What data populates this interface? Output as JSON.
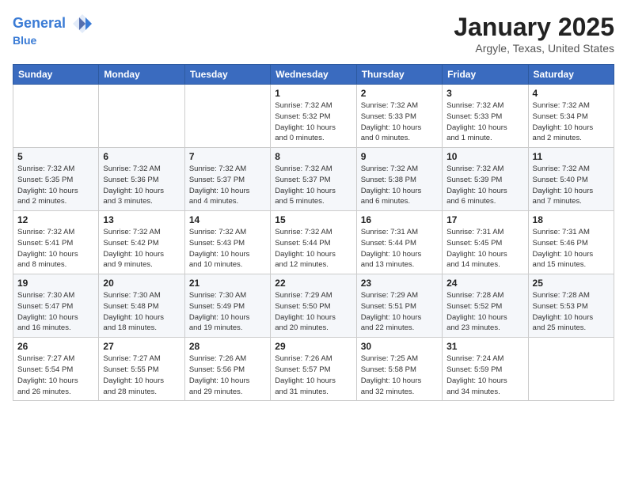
{
  "header": {
    "logo_line1": "General",
    "logo_line2": "Blue",
    "month": "January 2025",
    "location": "Argyle, Texas, United States"
  },
  "weekdays": [
    "Sunday",
    "Monday",
    "Tuesday",
    "Wednesday",
    "Thursday",
    "Friday",
    "Saturday"
  ],
  "weeks": [
    [
      {
        "day": "",
        "info": ""
      },
      {
        "day": "",
        "info": ""
      },
      {
        "day": "",
        "info": ""
      },
      {
        "day": "1",
        "info": "Sunrise: 7:32 AM\nSunset: 5:32 PM\nDaylight: 10 hours\nand 0 minutes."
      },
      {
        "day": "2",
        "info": "Sunrise: 7:32 AM\nSunset: 5:33 PM\nDaylight: 10 hours\nand 0 minutes."
      },
      {
        "day": "3",
        "info": "Sunrise: 7:32 AM\nSunset: 5:33 PM\nDaylight: 10 hours\nand 1 minute."
      },
      {
        "day": "4",
        "info": "Sunrise: 7:32 AM\nSunset: 5:34 PM\nDaylight: 10 hours\nand 2 minutes."
      }
    ],
    [
      {
        "day": "5",
        "info": "Sunrise: 7:32 AM\nSunset: 5:35 PM\nDaylight: 10 hours\nand 2 minutes."
      },
      {
        "day": "6",
        "info": "Sunrise: 7:32 AM\nSunset: 5:36 PM\nDaylight: 10 hours\nand 3 minutes."
      },
      {
        "day": "7",
        "info": "Sunrise: 7:32 AM\nSunset: 5:37 PM\nDaylight: 10 hours\nand 4 minutes."
      },
      {
        "day": "8",
        "info": "Sunrise: 7:32 AM\nSunset: 5:37 PM\nDaylight: 10 hours\nand 5 minutes."
      },
      {
        "day": "9",
        "info": "Sunrise: 7:32 AM\nSunset: 5:38 PM\nDaylight: 10 hours\nand 6 minutes."
      },
      {
        "day": "10",
        "info": "Sunrise: 7:32 AM\nSunset: 5:39 PM\nDaylight: 10 hours\nand 6 minutes."
      },
      {
        "day": "11",
        "info": "Sunrise: 7:32 AM\nSunset: 5:40 PM\nDaylight: 10 hours\nand 7 minutes."
      }
    ],
    [
      {
        "day": "12",
        "info": "Sunrise: 7:32 AM\nSunset: 5:41 PM\nDaylight: 10 hours\nand 8 minutes."
      },
      {
        "day": "13",
        "info": "Sunrise: 7:32 AM\nSunset: 5:42 PM\nDaylight: 10 hours\nand 9 minutes."
      },
      {
        "day": "14",
        "info": "Sunrise: 7:32 AM\nSunset: 5:43 PM\nDaylight: 10 hours\nand 10 minutes."
      },
      {
        "day": "15",
        "info": "Sunrise: 7:32 AM\nSunset: 5:44 PM\nDaylight: 10 hours\nand 12 minutes."
      },
      {
        "day": "16",
        "info": "Sunrise: 7:31 AM\nSunset: 5:44 PM\nDaylight: 10 hours\nand 13 minutes."
      },
      {
        "day": "17",
        "info": "Sunrise: 7:31 AM\nSunset: 5:45 PM\nDaylight: 10 hours\nand 14 minutes."
      },
      {
        "day": "18",
        "info": "Sunrise: 7:31 AM\nSunset: 5:46 PM\nDaylight: 10 hours\nand 15 minutes."
      }
    ],
    [
      {
        "day": "19",
        "info": "Sunrise: 7:30 AM\nSunset: 5:47 PM\nDaylight: 10 hours\nand 16 minutes."
      },
      {
        "day": "20",
        "info": "Sunrise: 7:30 AM\nSunset: 5:48 PM\nDaylight: 10 hours\nand 18 minutes."
      },
      {
        "day": "21",
        "info": "Sunrise: 7:30 AM\nSunset: 5:49 PM\nDaylight: 10 hours\nand 19 minutes."
      },
      {
        "day": "22",
        "info": "Sunrise: 7:29 AM\nSunset: 5:50 PM\nDaylight: 10 hours\nand 20 minutes."
      },
      {
        "day": "23",
        "info": "Sunrise: 7:29 AM\nSunset: 5:51 PM\nDaylight: 10 hours\nand 22 minutes."
      },
      {
        "day": "24",
        "info": "Sunrise: 7:28 AM\nSunset: 5:52 PM\nDaylight: 10 hours\nand 23 minutes."
      },
      {
        "day": "25",
        "info": "Sunrise: 7:28 AM\nSunset: 5:53 PM\nDaylight: 10 hours\nand 25 minutes."
      }
    ],
    [
      {
        "day": "26",
        "info": "Sunrise: 7:27 AM\nSunset: 5:54 PM\nDaylight: 10 hours\nand 26 minutes."
      },
      {
        "day": "27",
        "info": "Sunrise: 7:27 AM\nSunset: 5:55 PM\nDaylight: 10 hours\nand 28 minutes."
      },
      {
        "day": "28",
        "info": "Sunrise: 7:26 AM\nSunset: 5:56 PM\nDaylight: 10 hours\nand 29 minutes."
      },
      {
        "day": "29",
        "info": "Sunrise: 7:26 AM\nSunset: 5:57 PM\nDaylight: 10 hours\nand 31 minutes."
      },
      {
        "day": "30",
        "info": "Sunrise: 7:25 AM\nSunset: 5:58 PM\nDaylight: 10 hours\nand 32 minutes."
      },
      {
        "day": "31",
        "info": "Sunrise: 7:24 AM\nSunset: 5:59 PM\nDaylight: 10 hours\nand 34 minutes."
      },
      {
        "day": "",
        "info": ""
      }
    ]
  ]
}
